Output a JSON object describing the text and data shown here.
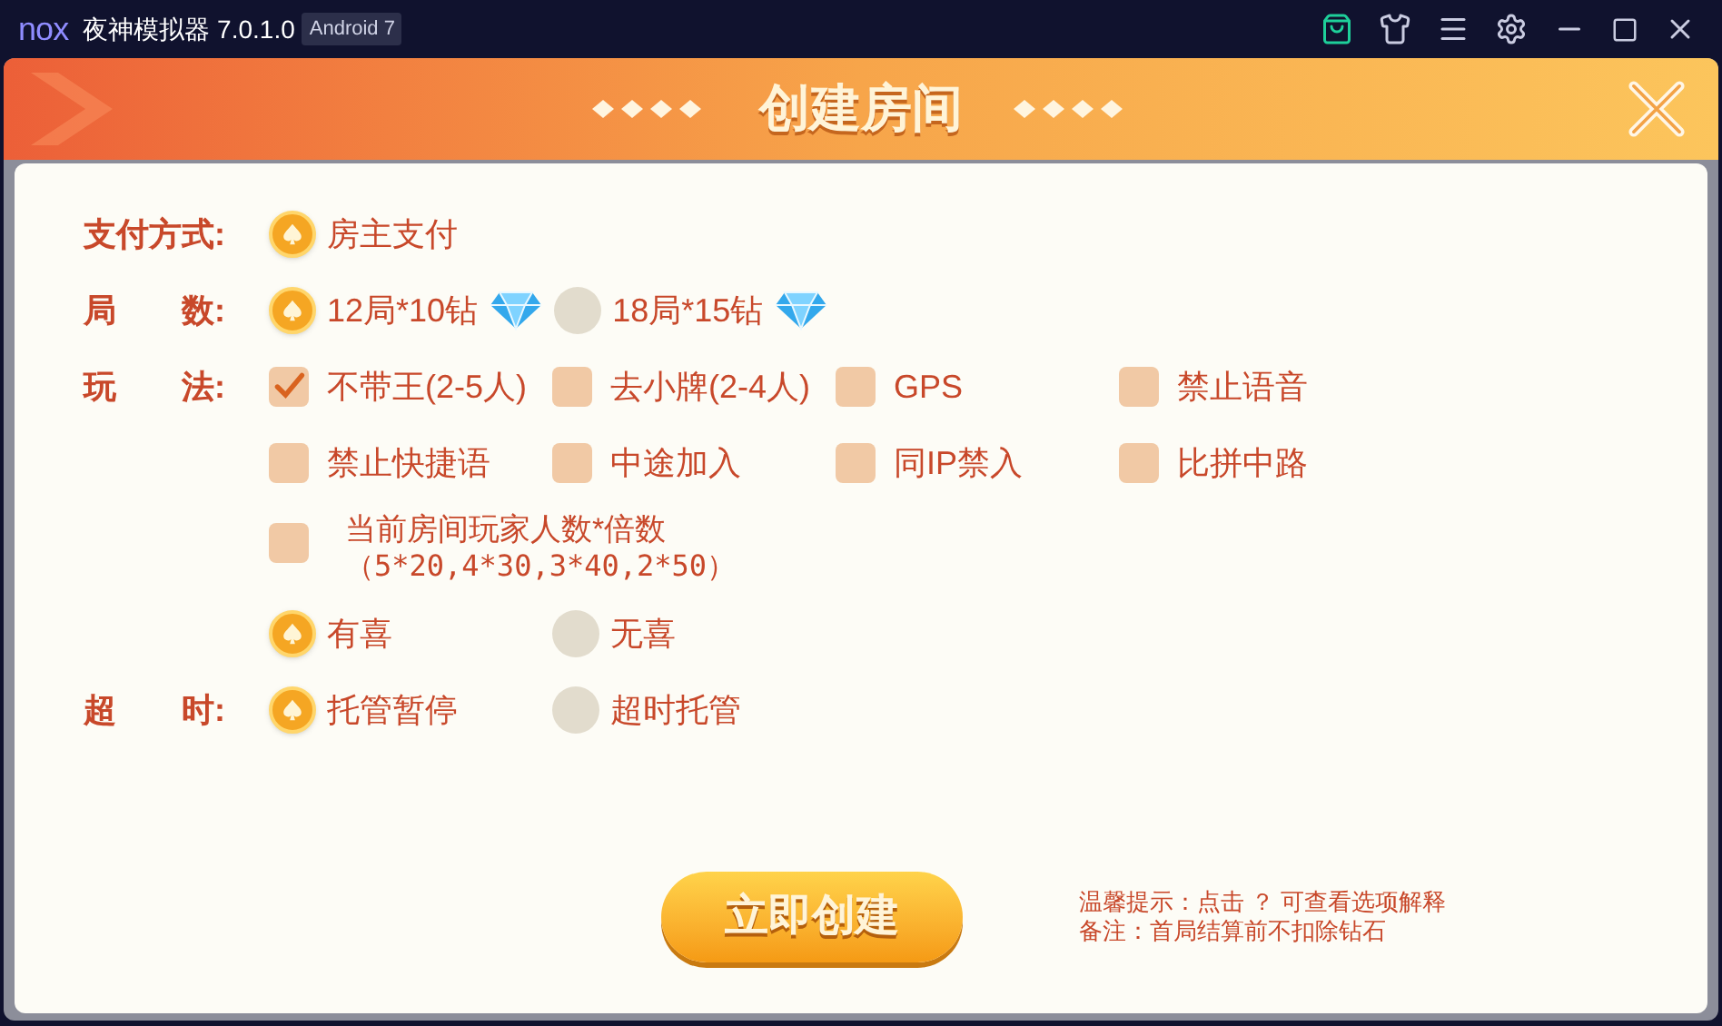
{
  "window": {
    "logo": "nox",
    "title": "夜神模拟器 7.0.1.0",
    "badge": "Android 7"
  },
  "dialog": {
    "title": "创建房间"
  },
  "rows": [
    {
      "label": "支付方式:",
      "options": [
        {
          "kind": "radio",
          "label": "房主支付",
          "selected": true,
          "gem": false
        }
      ]
    },
    {
      "label": "局　　数:",
      "options": [
        {
          "kind": "radio",
          "label": "12局*10钻",
          "selected": true,
          "gem": true
        },
        {
          "kind": "radio",
          "label": "18局*15钻",
          "selected": false,
          "gem": true
        }
      ]
    },
    {
      "label": "玩　　法:",
      "options": [
        {
          "kind": "checkbox",
          "label": "不带王(2-5人)",
          "checked": true
        },
        {
          "kind": "checkbox",
          "label": "去小牌(2-4人)",
          "checked": false
        },
        {
          "kind": "checkbox",
          "label": "GPS",
          "checked": false
        },
        {
          "kind": "checkbox",
          "label": "禁止语音",
          "checked": false
        },
        {
          "kind": "checkbox",
          "label": "禁止快捷语",
          "checked": false
        },
        {
          "kind": "checkbox",
          "label": "中途加入",
          "checked": false
        },
        {
          "kind": "checkbox",
          "label": "同IP禁入",
          "checked": false
        },
        {
          "kind": "checkbox",
          "label": "比拼中路",
          "checked": false
        },
        {
          "kind": "checkbox",
          "label": "当前房间玩家人数*倍数",
          "note": "（5*20,4*30,3*40,2*50）",
          "checked": false
        }
      ]
    },
    {
      "options": [
        {
          "kind": "radio",
          "label": "有喜",
          "selected": true,
          "gem": false
        },
        {
          "kind": "radio",
          "label": "无喜",
          "selected": false,
          "gem": false
        }
      ]
    },
    {
      "label": "超　　时:",
      "options": [
        {
          "kind": "radio",
          "label": "托管暂停",
          "selected": true,
          "gem": false
        },
        {
          "kind": "radio",
          "label": "超时托管",
          "selected": false,
          "gem": false
        }
      ]
    }
  ],
  "create_button": "立即创建",
  "hints": [
    "温馨提示：点击 ？ 可查看选项解释",
    "备注：首局结算前不扣除钻石"
  ]
}
